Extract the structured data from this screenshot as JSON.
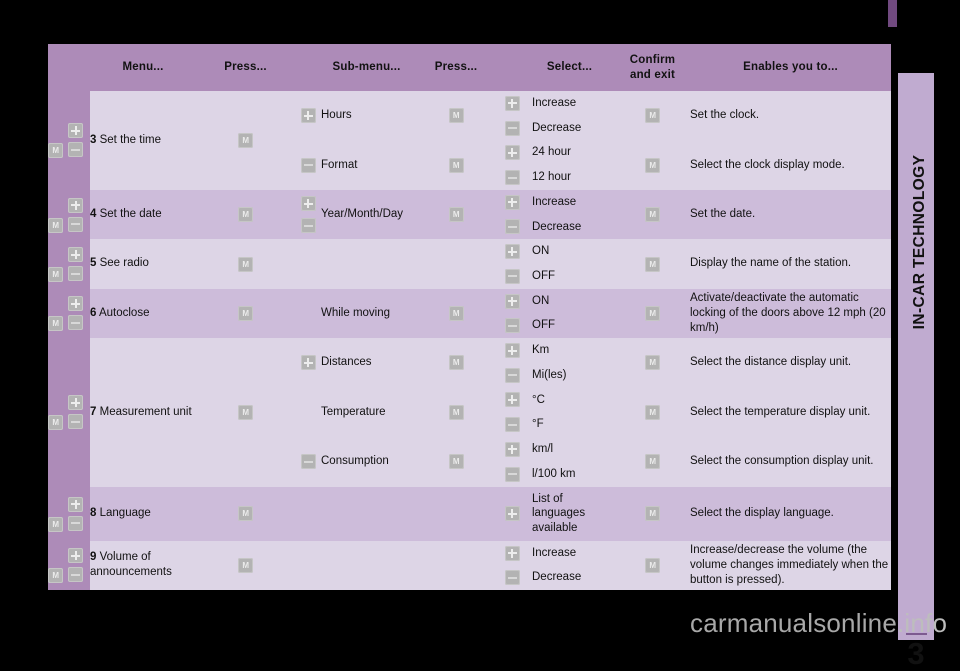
{
  "sidebar": {
    "section_label": "IN-CAR TECHNOLOGY",
    "chapter_number": "3"
  },
  "watermark": {
    "text": "carmanualsonline",
    "suffix": ".info"
  },
  "icons": {
    "mode": "M",
    "plus": "+",
    "minus": "−"
  },
  "table": {
    "headers": [
      "Menu...",
      "Press...",
      "Sub-menu...",
      "Press...",
      "Select...",
      "Confirm and exit",
      "Enables you to..."
    ],
    "header_confirm_line1": "Confirm",
    "header_confirm_line2": "and exit",
    "rows": [
      {
        "num": "3",
        "menu": "Set the time",
        "submenus": [
          {
            "label": "Hours",
            "icon": "plus",
            "selects": [
              "Increase",
              "Decrease"
            ],
            "enables": "Set the clock."
          },
          {
            "label": "Format",
            "icon": "minus",
            "selects": [
              "24 hour",
              "12 hour"
            ],
            "enables": "Select the clock display mode."
          }
        ]
      },
      {
        "num": "4",
        "menu": "Set the date",
        "submenus": [
          {
            "label": "Year/Month/Day",
            "icon": "stack",
            "selects": [
              "Increase",
              "Decrease"
            ],
            "enables": "Set the date."
          }
        ]
      },
      {
        "num": "5",
        "menu": "See radio",
        "submenus": [
          {
            "label": "",
            "icon": "none",
            "selects": [
              "ON",
              "OFF"
            ],
            "enables": "Display the name of the station."
          }
        ]
      },
      {
        "num": "6",
        "menu": "Autoclose",
        "submenus": [
          {
            "label": "While moving",
            "icon": "none",
            "selects": [
              "ON",
              "OFF"
            ],
            "enables": "Activate/deactivate the automatic locking of the doors above 12 mph (20 km/h)"
          }
        ]
      },
      {
        "num": "7",
        "menu": "Measurement unit",
        "submenus": [
          {
            "label": "Distances",
            "icon": "plus",
            "selects": [
              "Km",
              "Mi(les)"
            ],
            "enables": "Select the distance display unit."
          },
          {
            "label": "Temperature",
            "icon": "none",
            "selects": [
              "°C",
              "°F"
            ],
            "enables": "Select the temperature display unit."
          },
          {
            "label": "Consumption",
            "icon": "minus",
            "selects": [
              "km/l",
              "l/100 km"
            ],
            "enables": "Select the consumption display unit."
          }
        ]
      },
      {
        "num": "8",
        "menu": "Language",
        "submenus": [
          {
            "label": "",
            "icon": "none",
            "selects": [
              "List of languages available"
            ],
            "enables": "Select the display language."
          }
        ]
      },
      {
        "num": "9",
        "menu": "Volume of announcements",
        "submenus": [
          {
            "label": "",
            "icon": "none",
            "selects": [
              "Increase",
              "Decrease"
            ],
            "enables": "Increase/decrease the volume (the volume changes immediately when the button is pressed)."
          }
        ]
      }
    ]
  },
  "colors": {
    "header_bg": "#ad8bb8",
    "row_light": "#ddd5e6",
    "row_dark": "#cdbcda",
    "nav_col": "#ad8bb8",
    "sidebar": "#c0abd0",
    "page_bg": "#000000",
    "accent": "#714a80"
  }
}
